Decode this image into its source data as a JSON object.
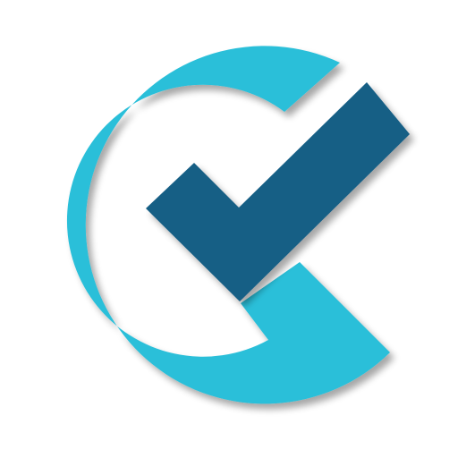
{
  "logo": {
    "icon": "c-checkmark-logo-icon",
    "colors": {
      "background": "#ffffff",
      "ring": "#29bfd9",
      "check": "#195e85",
      "shadow": "#9aa3a8"
    }
  }
}
